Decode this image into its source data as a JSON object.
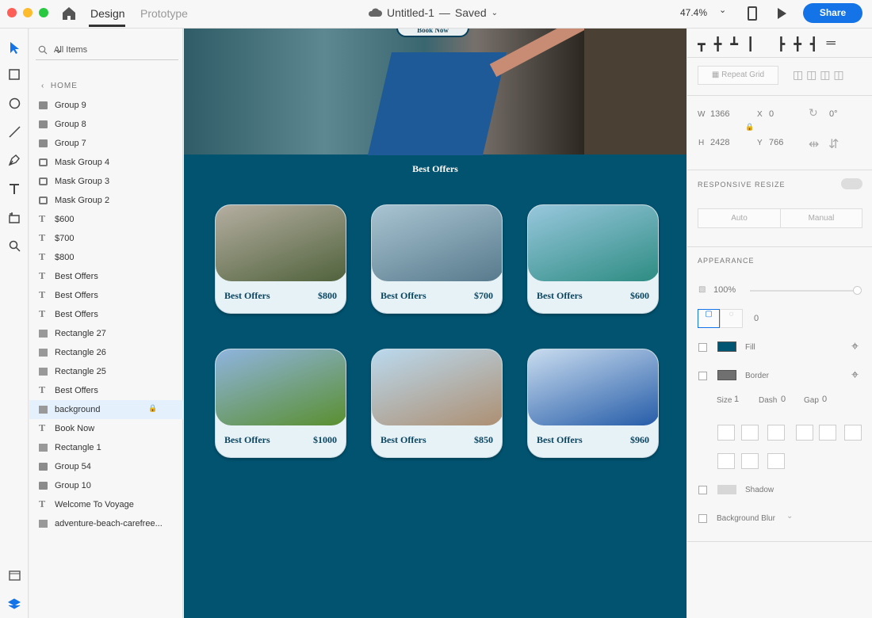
{
  "top": {
    "tabs": [
      "Design",
      "Prototype"
    ],
    "document": {
      "title": "Untitled-1",
      "separator": "—",
      "status": "Saved"
    },
    "zoom": "47.4%",
    "share": "Share"
  },
  "layers": {
    "search_placeholder": "All Items",
    "home_label": "HOME",
    "items": [
      {
        "type": "folder",
        "label": "Group 9"
      },
      {
        "type": "folder",
        "label": "Group 8"
      },
      {
        "type": "folder",
        "label": "Group 7"
      },
      {
        "type": "mask",
        "label": "Mask Group 4"
      },
      {
        "type": "mask",
        "label": "Mask Group 3"
      },
      {
        "type": "mask",
        "label": "Mask Group 2"
      },
      {
        "type": "text",
        "label": "$600"
      },
      {
        "type": "text",
        "label": "$700"
      },
      {
        "type": "text",
        "label": "$800"
      },
      {
        "type": "text",
        "label": "Best Offers"
      },
      {
        "type": "text",
        "label": "Best Offers"
      },
      {
        "type": "text",
        "label": "Best Offers"
      },
      {
        "type": "rect",
        "label": "Rectangle 27"
      },
      {
        "type": "rect",
        "label": "Rectangle 26"
      },
      {
        "type": "rect",
        "label": "Rectangle 25"
      },
      {
        "type": "text",
        "label": "Best Offers"
      },
      {
        "type": "rect",
        "label": "background",
        "selected": true,
        "locked": true
      },
      {
        "type": "text",
        "label": "Book Now"
      },
      {
        "type": "rect",
        "label": "Rectangle 1"
      },
      {
        "type": "folder",
        "label": "Group 54"
      },
      {
        "type": "folder",
        "label": "Group 10"
      },
      {
        "type": "text",
        "label": "Welcome To Voyage"
      },
      {
        "type": "rect",
        "label": "adventure-beach-carefree..."
      }
    ]
  },
  "canvas": {
    "hero_button": "Book Now",
    "heading": "Best Offers",
    "cards": [
      {
        "label": "Best Offers",
        "price": "$800",
        "photo": [
          "#b5aea1",
          "#50623c"
        ]
      },
      {
        "label": "Best Offers",
        "price": "$700",
        "photo": [
          "#a9c4d2",
          "#577a8c"
        ]
      },
      {
        "label": "Best Offers",
        "price": "$600",
        "photo": [
          "#98c7dd",
          "#2d8c82"
        ]
      },
      {
        "label": "Best Offers",
        "price": "$1000",
        "photo": [
          "#8fb4df",
          "#5a8f2f"
        ]
      },
      {
        "label": "Best Offers",
        "price": "$850",
        "photo": [
          "#bad9ee",
          "#ad8f72"
        ]
      },
      {
        "label": "Best Offers",
        "price": "$960",
        "photo": [
          "#c9dcef",
          "#255ca8"
        ]
      }
    ]
  },
  "properties": {
    "repeat_grid": "Repeat Grid",
    "w_label": "W",
    "w": "1366",
    "x_label": "X",
    "x": "0",
    "rotation": "0°",
    "h_label": "H",
    "h": "2428",
    "y_label": "Y",
    "y": "766",
    "responsive_resize": "RESPONSIVE RESIZE",
    "auto": "Auto",
    "manual": "Manual",
    "appearance": "APPEARANCE",
    "opacity": "100%",
    "radius": "0",
    "fill": "Fill",
    "fill_color": "#005672",
    "border": "Border",
    "border_color": "#707070",
    "size_label": "Size",
    "size": "1",
    "dash_label": "Dash",
    "dash": "0",
    "gap_label": "Gap",
    "gap": "0",
    "shadow": "Shadow",
    "background_blur": "Background Blur"
  }
}
